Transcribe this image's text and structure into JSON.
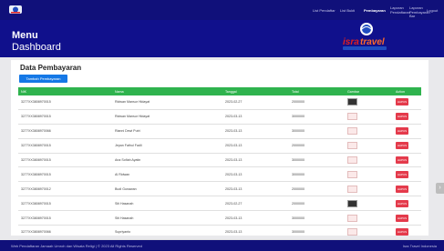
{
  "nav": {
    "items": [
      {
        "label": "List Pendaftar"
      },
      {
        "label": "List Bukti"
      },
      {
        "label": "Pembayaran"
      },
      {
        "label": "Laporan Pendaftaran"
      },
      {
        "label": "Laporan Pembayaran Bar"
      },
      {
        "label": "Logout"
      }
    ]
  },
  "header": {
    "title": "Menu",
    "subtitle": "Dashboard",
    "brand": "Isra Travel"
  },
  "main": {
    "title": "Data Pembayaran",
    "add_button": "Tambah Pembayaran",
    "columns": [
      "NIK",
      "Nama",
      "Tanggal",
      "Total",
      "Gambar",
      "Action"
    ],
    "rows": [
      {
        "nik": "3277XX3808970015",
        "nama": "Ridwan Mansur Hidayat",
        "tanggal": "2023-02-27",
        "total": "2000000",
        "img": "dark",
        "action": "HAPUS"
      },
      {
        "nik": "3277XX3808970015",
        "nama": "Ridwan Mansur Hidayat",
        "tanggal": "2023-03-13",
        "total": "3000000",
        "img": "slip",
        "action": "HAPUS"
      },
      {
        "nik": "3277XX3808970066",
        "nama": "Rianni Dewi Putri",
        "tanggal": "2023-03-13",
        "total": "3000000",
        "img": "slip",
        "action": "HAPUS"
      },
      {
        "nik": "3277XX3808970015",
        "nama": "Jepan Fathul Fadli",
        "tanggal": "2023-03-13",
        "total": "2000000",
        "img": "slip",
        "action": "HAPUS"
      },
      {
        "nik": "3277XX3808970015",
        "nama": "Ana Sofiah Ayatin",
        "tanggal": "2023-03-13",
        "total": "3000000",
        "img": "slip",
        "action": "HAPUS"
      },
      {
        "nik": "3277XX3808970015",
        "nama": "Al Ridwan",
        "tanggal": "2023-03-13",
        "total": "3000000",
        "img": "slip",
        "action": "HAPUS"
      },
      {
        "nik": "3277XX3808970012",
        "nama": "Budi Gunawan",
        "tanggal": "2023-03-13",
        "total": "2000000",
        "img": "slip",
        "action": "HAPUS"
      },
      {
        "nik": "3277XX3808970015",
        "nama": "Siti Hasanah",
        "tanggal": "2023-02-27",
        "total": "2000000",
        "img": "dark",
        "action": "HAPUS"
      },
      {
        "nik": "3277XX3808970015",
        "nama": "Siti Hasanah",
        "tanggal": "2023-03-13",
        "total": "3000000",
        "img": "slip",
        "action": "HAPUS"
      },
      {
        "nik": "3277XX3808970066",
        "nama": "Supriyanto",
        "tanggal": "2023-03-13",
        "total": "3000000",
        "img": "slip",
        "action": "HAPUS"
      }
    ]
  },
  "footer": {
    "left": "Web Pendaftaran Jamaah Umroh dan Wisata Religi | © 2023 All Rights Reserved",
    "right": "Isra Travel Indonesia"
  },
  "colors": {
    "navy": "#10108c",
    "green": "#2fb34e",
    "red": "#e43a4b",
    "blue": "#1578e6"
  }
}
